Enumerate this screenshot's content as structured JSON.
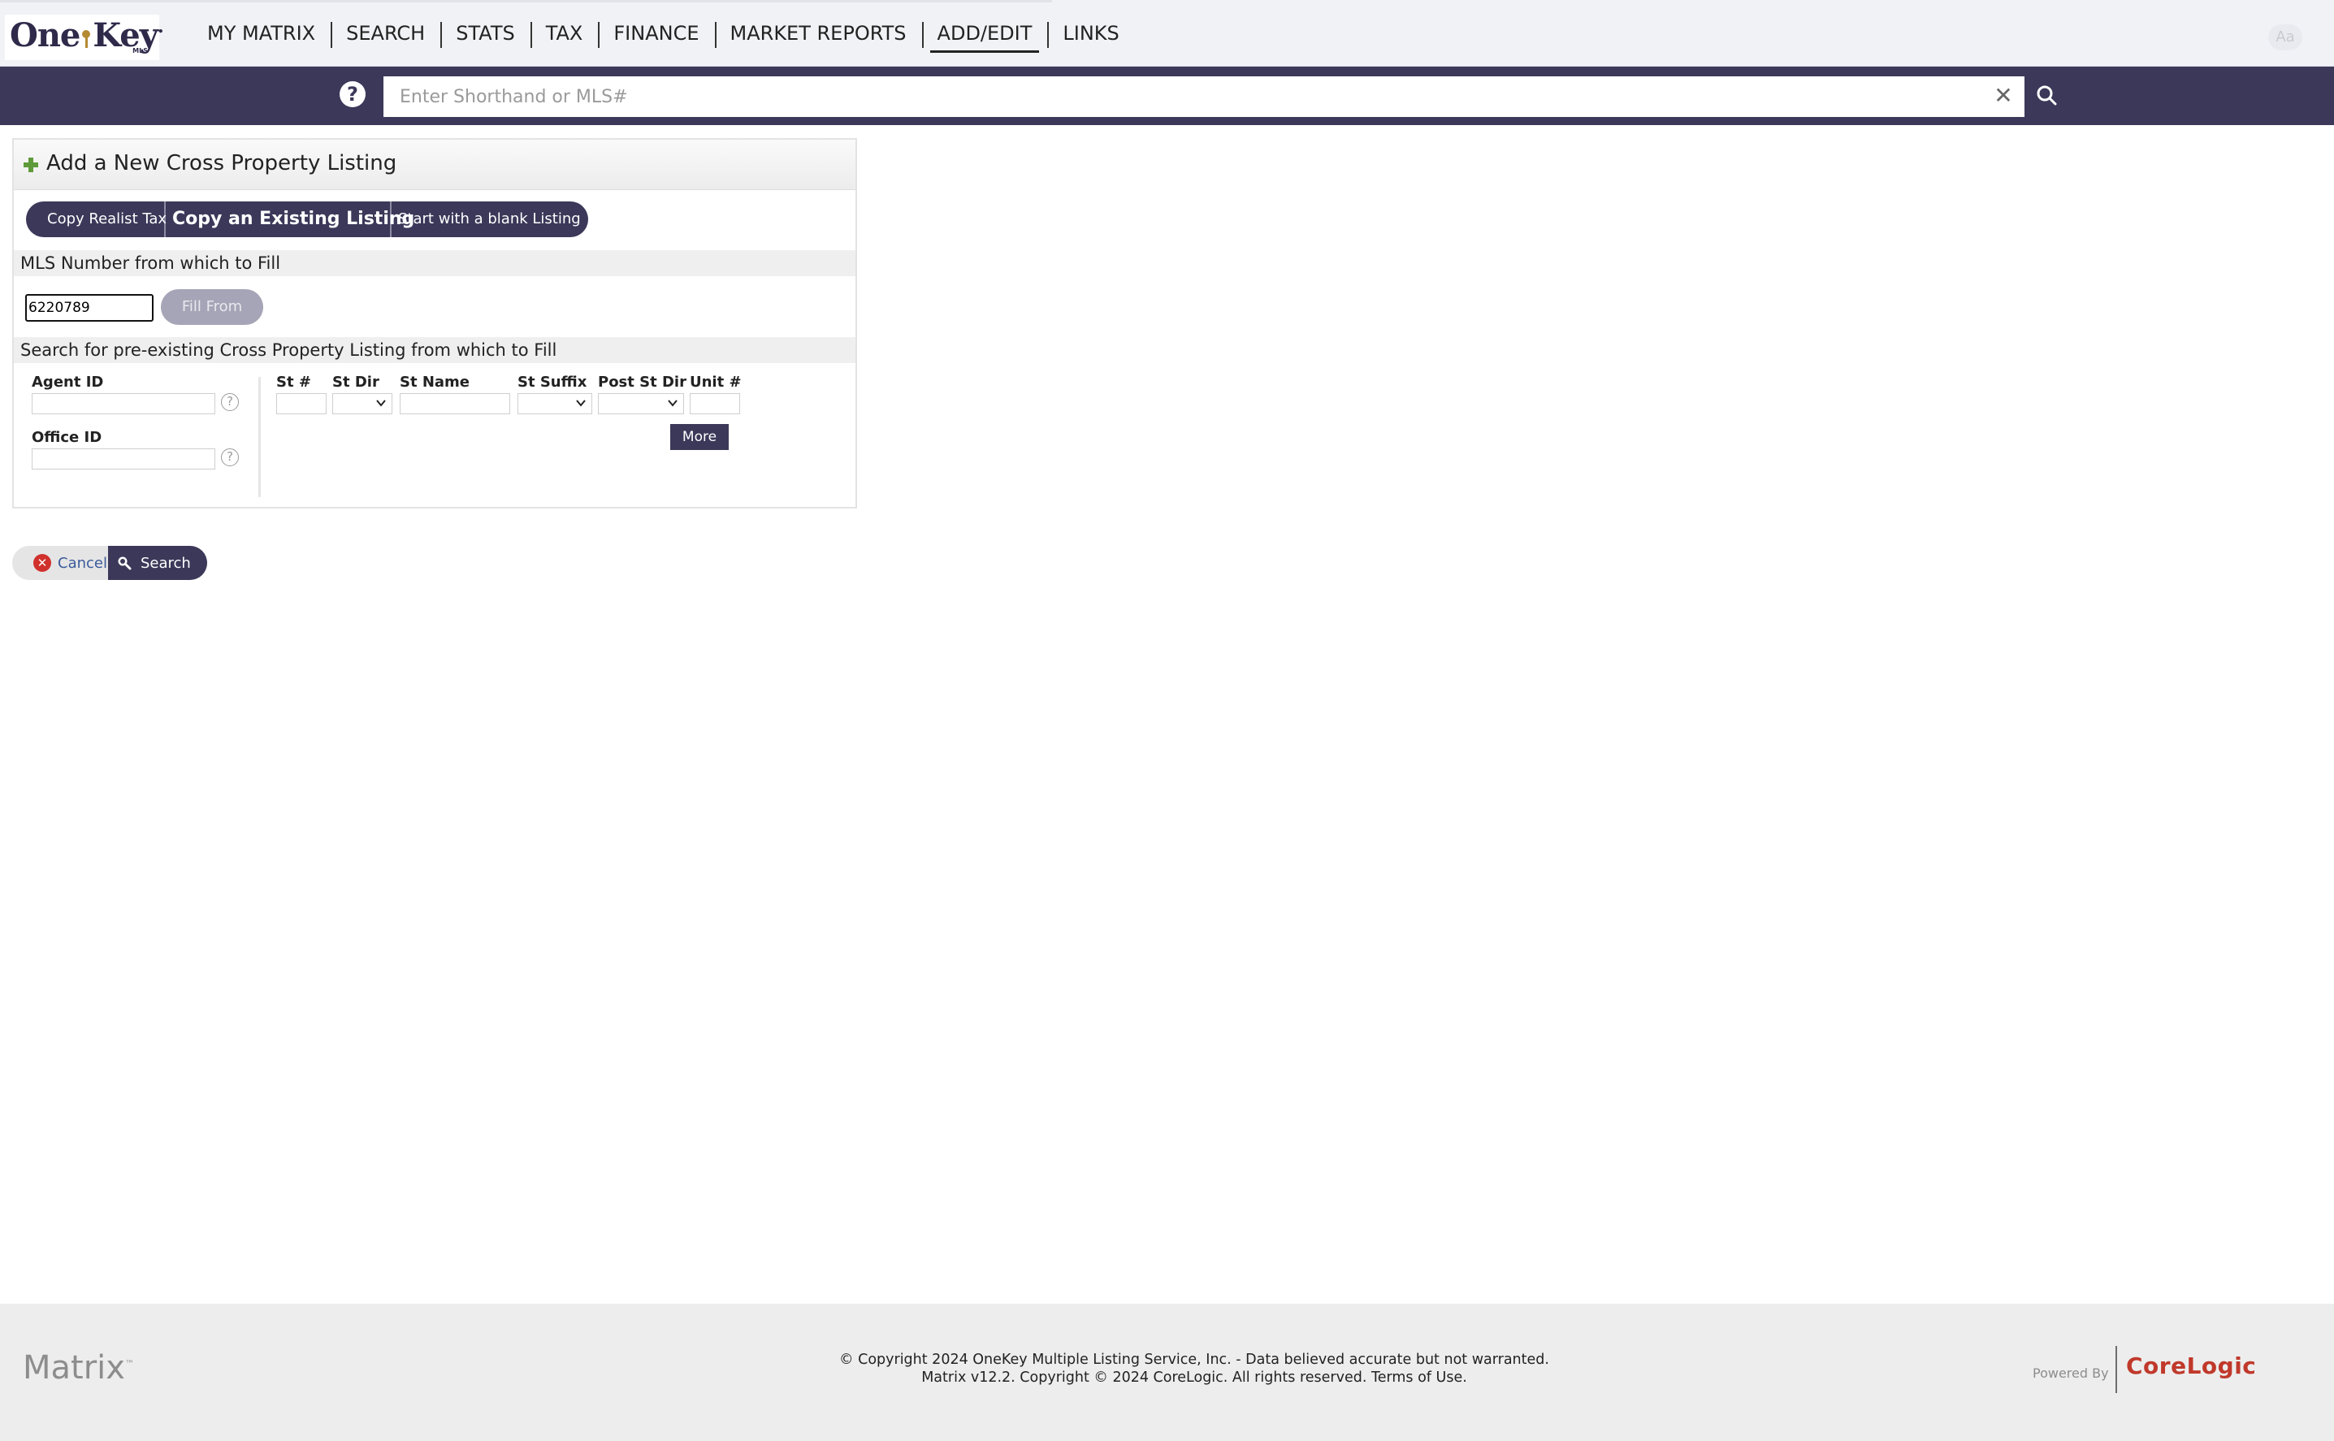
{
  "brand": {
    "logo_text_left": "One",
    "logo_text_right": "Key",
    "logo_sub": "MLS"
  },
  "nav": {
    "items": [
      {
        "label": "MY MATRIX"
      },
      {
        "label": "SEARCH"
      },
      {
        "label": "STATS"
      },
      {
        "label": "TAX"
      },
      {
        "label": "FINANCE"
      },
      {
        "label": "MARKET REPORTS"
      },
      {
        "label": "ADD/EDIT",
        "active": true
      },
      {
        "label": "LINKS"
      }
    ],
    "font_toggle": "Aa"
  },
  "search_bar": {
    "help": "?",
    "placeholder": "Enter Shorthand or MLS#",
    "value": "",
    "clear": "✕"
  },
  "panel": {
    "title": "Add a New Cross Property Listing",
    "tabs": [
      {
        "label": "Copy Realist Tax"
      },
      {
        "label": "Copy an Existing Listing",
        "selected": true
      },
      {
        "label": "Start with a blank Listing"
      }
    ],
    "mls_section": {
      "heading": "MLS Number from which to Fill",
      "mls_value": "6220789",
      "fill_button": "Fill From"
    },
    "search_section": {
      "heading": "Search for pre-existing Cross Property Listing from which to Fill",
      "agent_id_label": "Agent ID",
      "office_id_label": "Office ID",
      "help_mark": "?",
      "address_fields": {
        "st_num": "St #",
        "st_dir": "St Dir",
        "st_name": "St Name",
        "st_suffix": "St Suffix",
        "post_st_dir": "Post St Dir",
        "unit_num": "Unit #"
      },
      "more_button": "More"
    }
  },
  "actions": {
    "cancel": "Cancel",
    "cancel_icon": "✕",
    "search": "Search"
  },
  "footer": {
    "matrix_logo": "Matrix",
    "copyright_line1": "© Copyright 2024 OneKey Multiple Listing Service, Inc. - Data believed accurate but not warranted.",
    "copyright_line2": "Matrix v12.2. Copyright © 2024 CoreLogic. All rights reserved.",
    "terms_link": "Terms of Use.",
    "powered_by": "Powered By",
    "corelogic": "CoreLogic"
  },
  "colors": {
    "band": "#3b3859",
    "accent_green": "#5f9a3a",
    "cancel_red": "#d0312d",
    "corelogic_red": "#c0392b"
  }
}
